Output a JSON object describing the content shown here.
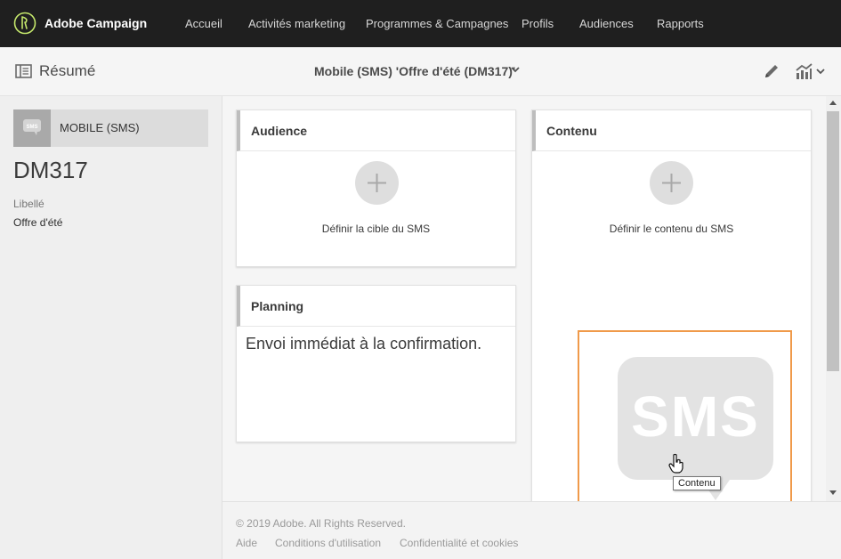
{
  "app": {
    "name": "Adobe Campaign",
    "logo_icon": "adobe-campaign-logo-icon",
    "accent_color": "#c5e86c"
  },
  "nav": {
    "items": [
      {
        "label": "Accueil"
      },
      {
        "label": "Activités marketing"
      },
      {
        "label": "Programmes & Campagnes"
      },
      {
        "label": "Profils"
      },
      {
        "label": "Audiences"
      },
      {
        "label": "Rapports"
      }
    ]
  },
  "subheader": {
    "summary_label": "Résumé",
    "delivery_title": "Mobile (SMS) 'Offre d'été (DM317)'",
    "icons": [
      "summary-panel-icon",
      "chevron-down-icon",
      "pencil-icon",
      "report-chart-icon"
    ]
  },
  "left_panel": {
    "channel_label": "MOBILE (SMS)",
    "channel_icon": "sms-bubble-icon",
    "delivery_code": "DM317",
    "label_title": "Libellé",
    "label_value": "Offre d'été"
  },
  "cards": {
    "audience": {
      "title": "Audience",
      "action": "Définir la cible du SMS"
    },
    "planning": {
      "title": "Planning",
      "text": "Envoi immédiat à la confirmation."
    },
    "content": {
      "title": "Contenu",
      "action": "Définir le contenu du SMS",
      "preview_text": "SMS",
      "tooltip": "Contenu"
    }
  },
  "highlight_color": "#f09a4a",
  "footer": {
    "copyright": "© 2019 Adobe. All Rights Reserved.",
    "links": [
      {
        "label": "Aide"
      },
      {
        "label": "Conditions d'utilisation"
      },
      {
        "label": "Confidentialité et cookies"
      }
    ]
  }
}
